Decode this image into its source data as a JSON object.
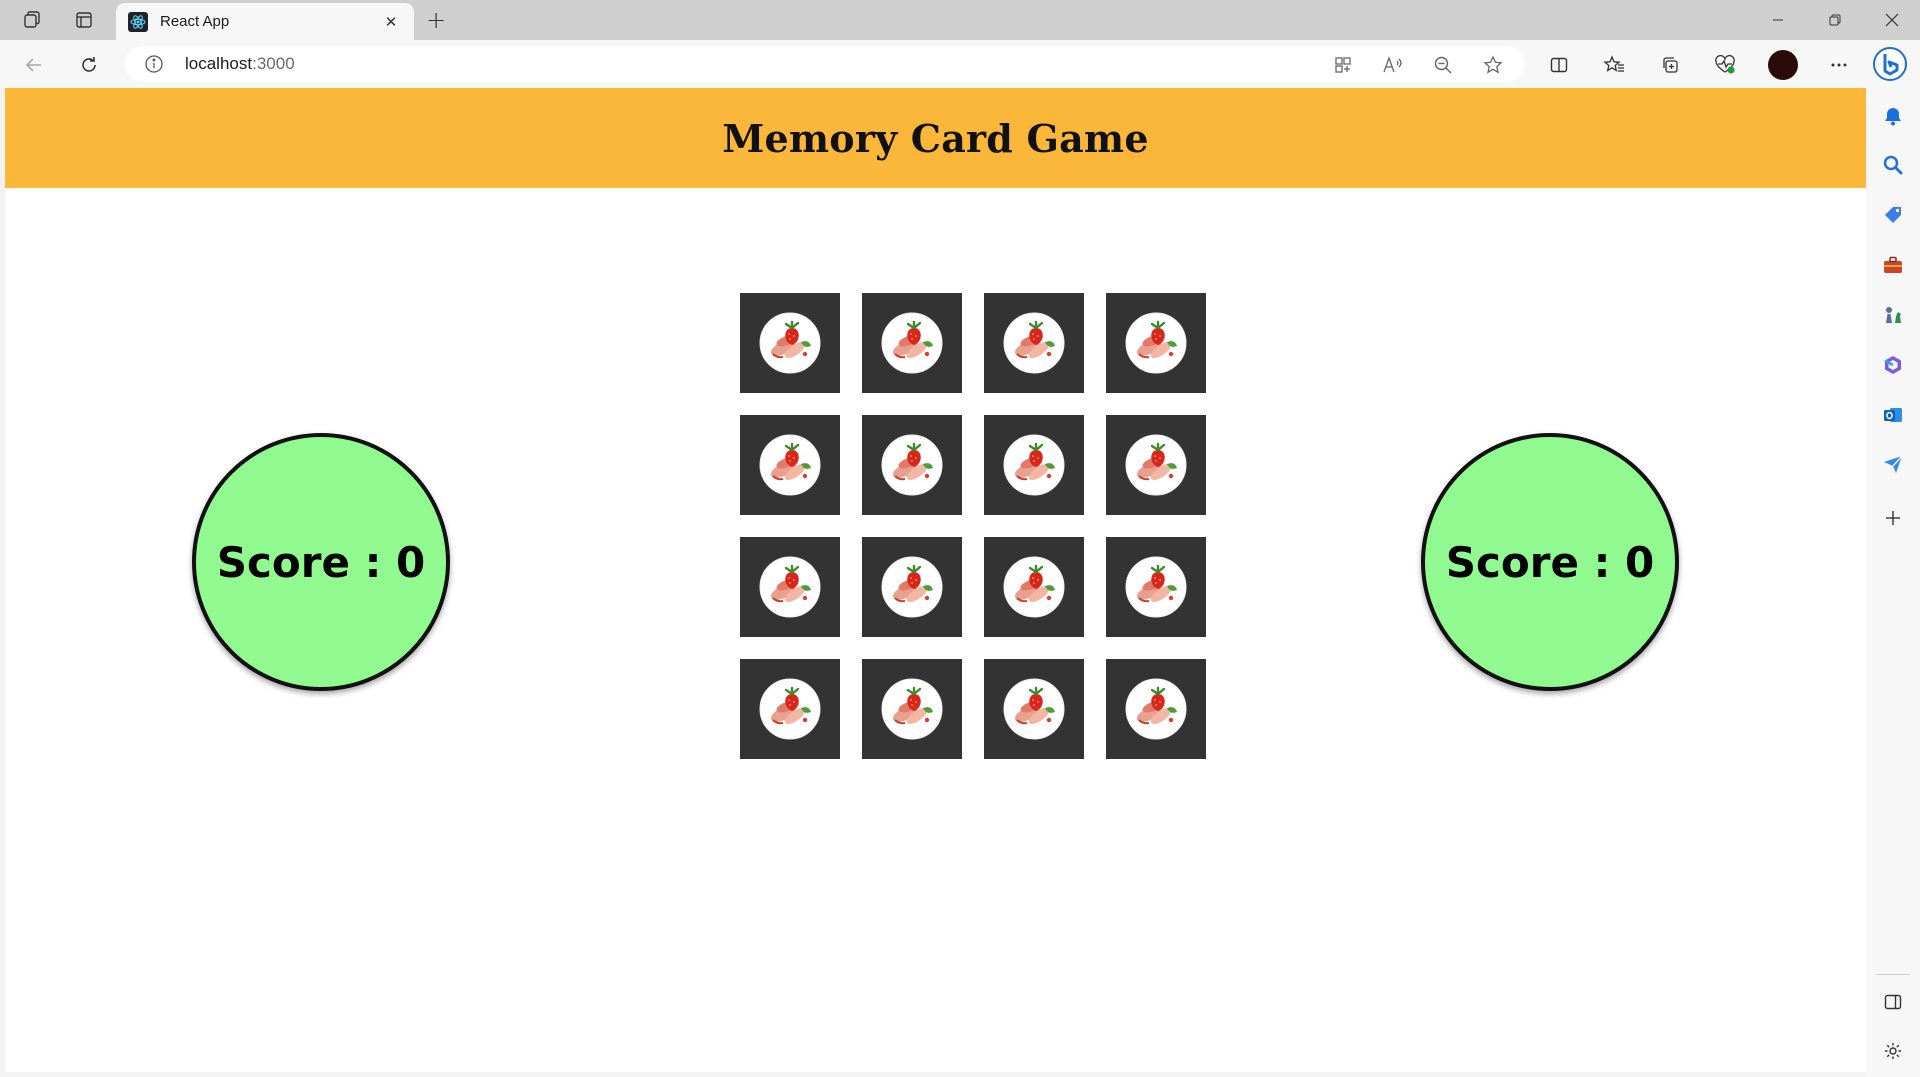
{
  "browser": {
    "tab": {
      "title": "React App"
    },
    "address": {
      "host": "localhost",
      "port": ":3000"
    }
  },
  "app": {
    "title": "Memory Card Game",
    "players": [
      {
        "score_label": "Score : 0"
      },
      {
        "score_label": "Score : 0"
      }
    ],
    "card_back_image": "strawberry-plate",
    "card_count": 16
  },
  "colors": {
    "header": "#fbb739",
    "score_circle": "#90f990",
    "card_back": "#333333"
  }
}
